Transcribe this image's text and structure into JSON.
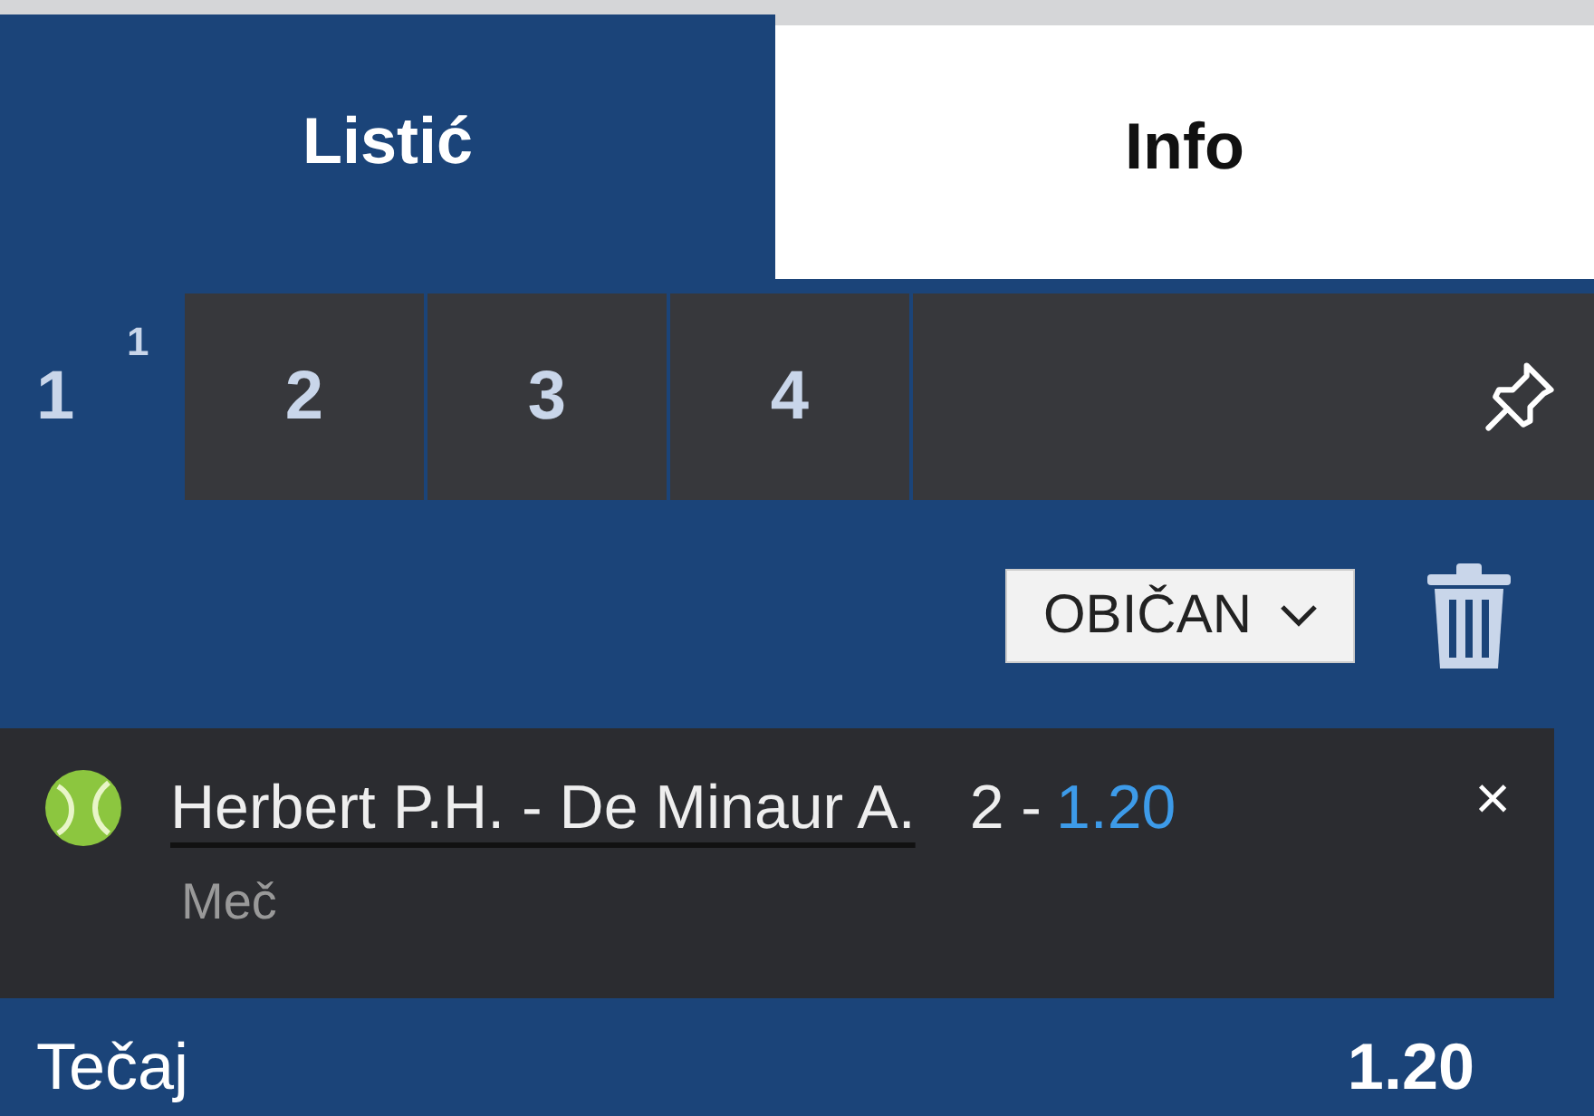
{
  "tabs": [
    {
      "label": "Listić",
      "selected": true
    },
    {
      "label": "Info",
      "selected": false
    }
  ],
  "slips": [
    {
      "label": "1",
      "badge": "1",
      "selected": true
    },
    {
      "label": "2",
      "selected": false
    },
    {
      "label": "3",
      "selected": false
    },
    {
      "label": "4",
      "selected": false
    }
  ],
  "bet_type": {
    "value": "OBIČAN"
  },
  "bets": [
    {
      "match": "Herbert P.H. - De Minaur A.",
      "pick": "2 -",
      "odds": "1.20",
      "market": "Meč",
      "remove": "×"
    }
  ],
  "total": {
    "label": "Tečaj",
    "value": "1.20"
  }
}
